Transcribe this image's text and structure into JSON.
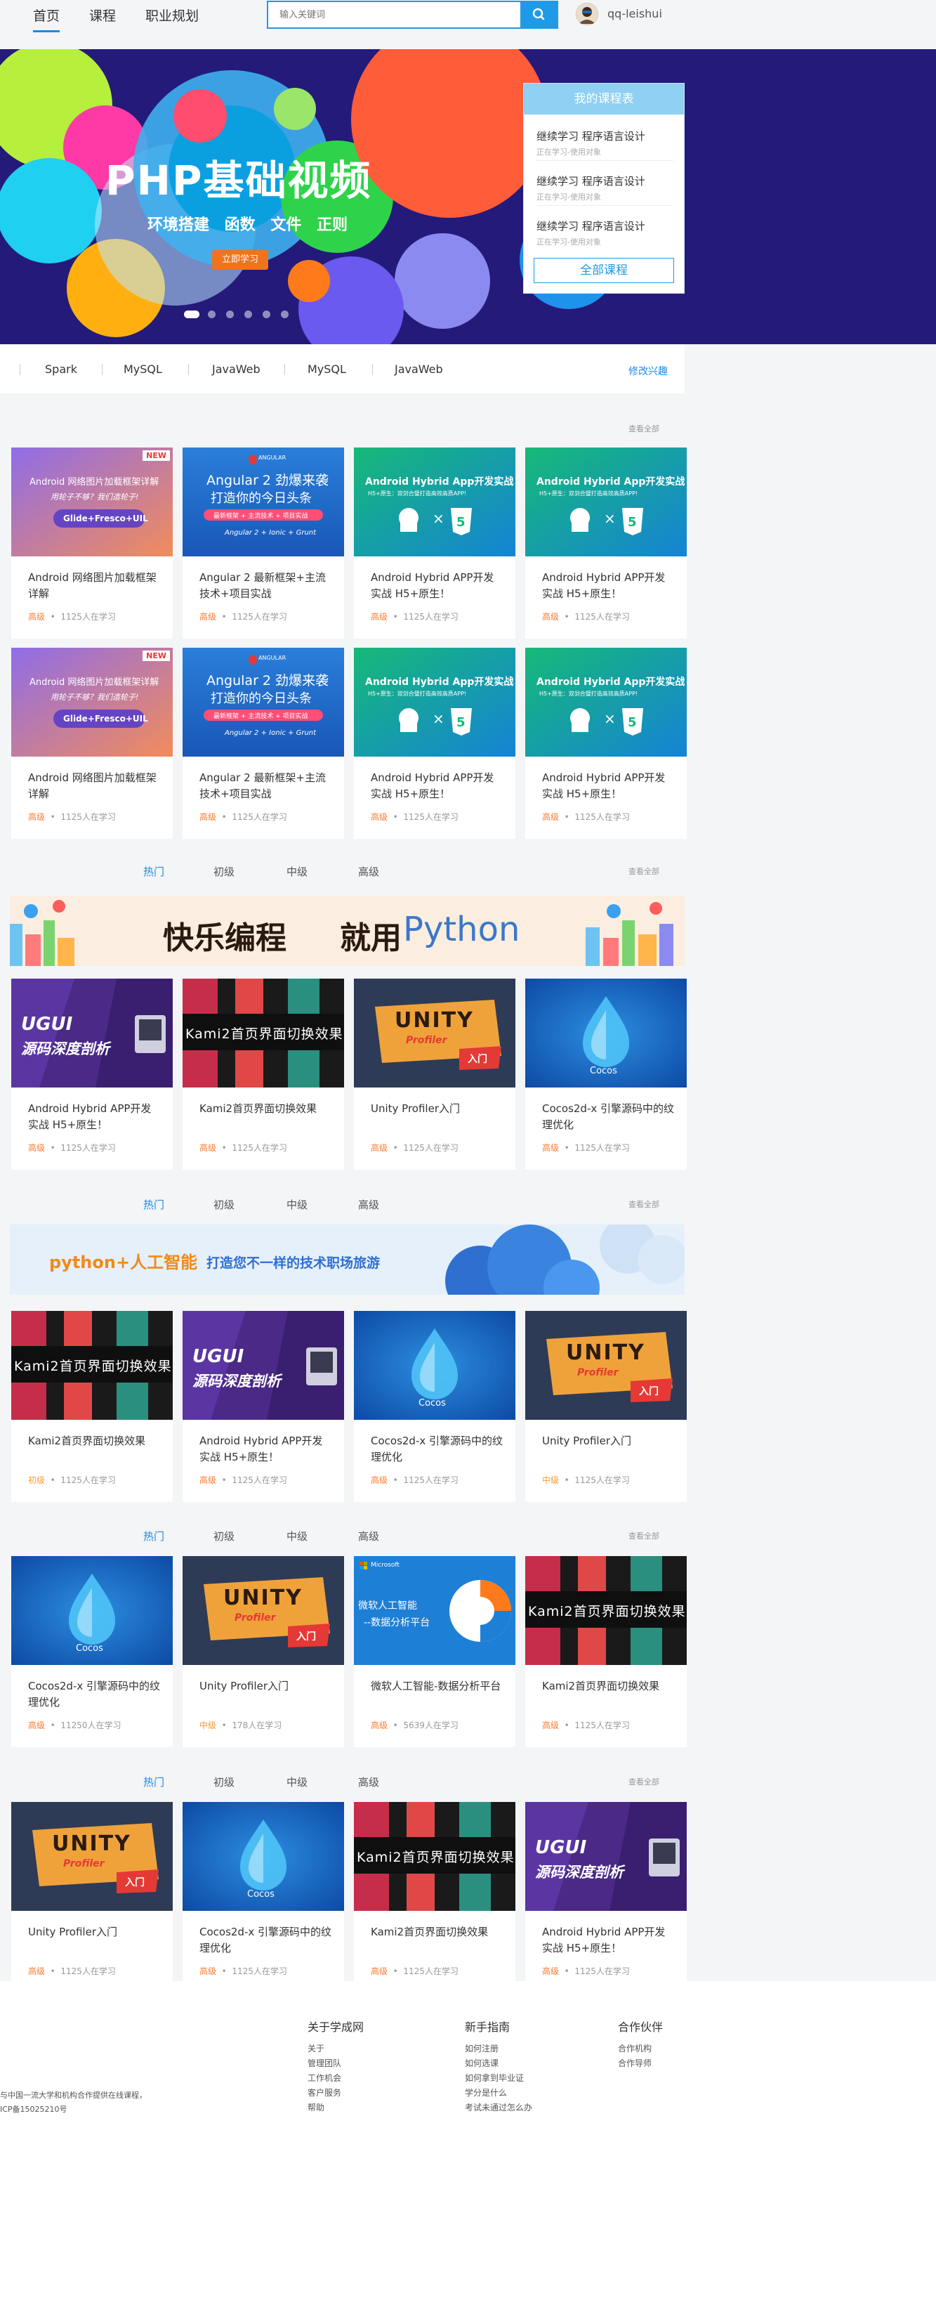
{
  "nav": {
    "items": [
      "首页",
      "课程",
      "职业规划"
    ]
  },
  "search": {
    "placeholder": "输入关键词"
  },
  "user": {
    "name": "qq-leishui"
  },
  "banner": {
    "title": "PHP基础视频",
    "subtitle": "环境搭建 函数 文件 正则",
    "button": "立即学习"
  },
  "schedule": {
    "title": "我的课程表",
    "items": [
      {
        "title": "继续学习 程序语言设计",
        "sub": "正在学习-使用对象"
      },
      {
        "title": "继续学习 程序语言设计",
        "sub": "正在学习-使用对象"
      },
      {
        "title": "继续学习 程序语言设计",
        "sub": "正在学习-使用对象"
      }
    ],
    "all_button": "全部课程"
  },
  "tags": {
    "items": [
      "Spark",
      "MySQL",
      "JavaWeb",
      "MySQL",
      "JavaWeb"
    ],
    "edit": "修改兴趣"
  },
  "common": {
    "see_all": "查看全部",
    "tabs": [
      "热门",
      "初级",
      "中级",
      "高级"
    ]
  },
  "thumbs": {
    "android_title": "Android 网络图片加载框架详解",
    "android_sub": "用轮子不够？我们造轮子!",
    "android_lib": "Glide+Fresco+UIL",
    "badge_new": "NEW",
    "angular_brand": "ANGULAR",
    "angular_title": "Angular 2 劲爆来袭",
    "angular_sub": "打造你的今日头条",
    "angular_tag": "最新框架 + 主流技术 + 项目实战",
    "angular_stack": "Angular 2 + Ionic + Grunt",
    "hybrid_title": "Android Hybrid App开发实战",
    "hybrid_sub": "H5+原生：双剑合璧打造高效高质APP!",
    "ugui": "UGUI",
    "ugui_sub": "源码深度剖析",
    "kami": "Kami2首页界面切换效果",
    "unity": "UNITY",
    "unity_sub": "Profiler",
    "unity_rumen": "入门",
    "cocos": "Cocos",
    "ms_brand": "Microsoft",
    "ms_title": "微软人工智能",
    "ms_sub": "--数据分析平台"
  },
  "promos": {
    "python_left": "快乐编程",
    "python_mid": "就用",
    "python_word": "Python",
    "ai_left": "python+人工智能",
    "ai_right": "打造您不一样的技术职场旅游"
  },
  "sections": [
    {
      "cards": [
        {
          "thumb": "android",
          "title": "Android 网络图片加载框架详解",
          "level": "高级",
          "count": "1125人在学习"
        },
        {
          "thumb": "angular",
          "title": "Angular 2 最新框架+主流技术+项目实战",
          "level": "高级",
          "count": "1125人在学习"
        },
        {
          "thumb": "hybrid",
          "title": "Android Hybrid APP开发实战 H5+原生！",
          "level": "高级",
          "count": "1125人在学习"
        },
        {
          "thumb": "hybrid",
          "title": "Android Hybrid APP开发实战 H5+原生！",
          "level": "高级",
          "count": "1125人在学习"
        },
        {
          "thumb": "android",
          "title": "Android 网络图片加载框架详解",
          "level": "高级",
          "count": "1125人在学习"
        },
        {
          "thumb": "angular",
          "title": "Angular 2 最新框架+主流技术+项目实战",
          "level": "高级",
          "count": "1125人在学习"
        },
        {
          "thumb": "hybrid",
          "title": "Android Hybrid APP开发实战 H5+原生！",
          "level": "高级",
          "count": "1125人在学习"
        },
        {
          "thumb": "hybrid",
          "title": "Android Hybrid APP开发实战 H5+原生！",
          "level": "高级",
          "count": "1125人在学习"
        }
      ]
    },
    {
      "cards": [
        {
          "thumb": "ugui",
          "title": "Android Hybrid APP开发实战 H5+原生！",
          "level": "高级",
          "count": "1125人在学习"
        },
        {
          "thumb": "kami",
          "title": "Kami2首页界面切换效果",
          "level": "高级",
          "count": "1125人在学习"
        },
        {
          "thumb": "unity",
          "title": "Unity Profiler入门",
          "level": "高级",
          "count": "1125人在学习"
        },
        {
          "thumb": "cocos",
          "title": "Cocos2d-x 引擎源码中的纹理优化",
          "level": "高级",
          "count": "1125人在学习"
        }
      ]
    },
    {
      "cards": [
        {
          "thumb": "kami",
          "title": "Kami2首页界面切换效果",
          "level": "初级",
          "count": "1125人在学习"
        },
        {
          "thumb": "ugui",
          "title": "Android Hybrid APP开发实战 H5+原生！",
          "level": "高级",
          "count": "1125人在学习"
        },
        {
          "thumb": "cocos",
          "title": "Cocos2d-x 引擎源码中的纹理优化",
          "level": "高级",
          "count": "1125人在学习"
        },
        {
          "thumb": "unity",
          "title": "Unity Profiler入门",
          "level": "中级",
          "count": "1125人在学习"
        }
      ]
    },
    {
      "cards": [
        {
          "thumb": "cocos",
          "title": "Cocos2d-x 引擎源码中的纹理优化",
          "level": "高级",
          "count": "11250人在学习"
        },
        {
          "thumb": "unity",
          "title": "Unity Profiler入门",
          "level": "中级",
          "count": "178人在学习"
        },
        {
          "thumb": "ms",
          "title": "微软人工智能-数据分析平台",
          "level": "高级",
          "count": "5639人在学习"
        },
        {
          "thumb": "kami",
          "title": "Kami2首页界面切换效果",
          "level": "高级",
          "count": "1125人在学习"
        }
      ]
    },
    {
      "cards": [
        {
          "thumb": "unity",
          "title": "Unity Profiler入门",
          "level": "高级",
          "count": "1125人在学习"
        },
        {
          "thumb": "cocos",
          "title": "Cocos2d-x 引擎源码中的纹理优化",
          "level": "高级",
          "count": "1125人在学习"
        },
        {
          "thumb": "kami",
          "title": "Kami2首页界面切换效果",
          "level": "高级",
          "count": "1125人在学习"
        },
        {
          "thumb": "ugui",
          "title": "Android Hybrid APP开发实战 H5+原生！",
          "level": "高级",
          "count": "1125人在学习"
        }
      ]
    }
  ],
  "footer": {
    "left_lines": [
      "与中国一流大学和机构合作提供在线课程，",
      "ICP备15025210号"
    ],
    "columns": [
      {
        "head": "关于学成网",
        "links": [
          "关于",
          "管理团队",
          "工作机会",
          "客户服务",
          "帮助"
        ]
      },
      {
        "head": "新手指南",
        "links": [
          "如何注册",
          "如何选课",
          "如何拿到毕业证",
          "学分是什么",
          "考试未通过怎么办"
        ]
      },
      {
        "head": "合作伙伴",
        "links": [
          "合作机构",
          "合作导师"
        ]
      }
    ]
  },
  "colors": {
    "accent": "#1e88e5",
    "level": "#ff7a2e",
    "banner_bg": "#241a7a"
  }
}
